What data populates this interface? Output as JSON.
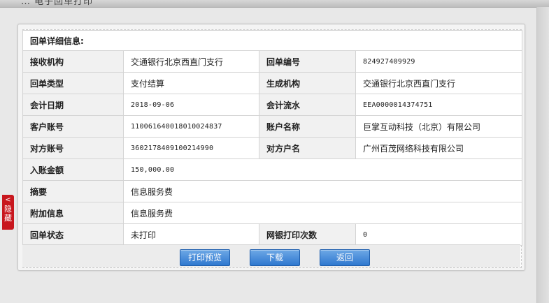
{
  "top_bar": {
    "breadcrumb": "… 电子回单打印"
  },
  "side_tab": {
    "label": "隐藏",
    "arrow": "<"
  },
  "receipt": {
    "header": "回单详细信息:",
    "rows": [
      {
        "l1": "接收机构",
        "v1": "交通银行北京西直门支行",
        "l2": "回单编号",
        "v2": "824927409929"
      },
      {
        "l1": "回单类型",
        "v1": "支付结算",
        "l2": "生成机构",
        "v2": "交通银行北京西直门支行"
      },
      {
        "l1": "会计日期",
        "v1": "2018-09-06",
        "l2": "会计流水",
        "v2": "EEA0000014374751"
      },
      {
        "l1": "客户账号",
        "v1": "110061640018010024837",
        "l2": "账户名称",
        "v2": "巨掌互动科技（北京）有限公司"
      },
      {
        "l1": "对方账号",
        "v1": "360217840910021499​0",
        "l2": "对方户名",
        "v2": "广州百茂网络科技有限公司"
      }
    ],
    "amount_label": "入账金额",
    "amount_value": "150,000.00",
    "summary_label": "摘要",
    "summary_value": "信息服务费",
    "extra_label": "附加信息",
    "extra_value": "信息服务费",
    "status_label": "回单状态",
    "status_value": "未打印",
    "print_count_label": "网银打印次数",
    "print_count_value": "0"
  },
  "buttons": {
    "print_preview": "打印预览",
    "download": "下载",
    "back": "返回"
  }
}
